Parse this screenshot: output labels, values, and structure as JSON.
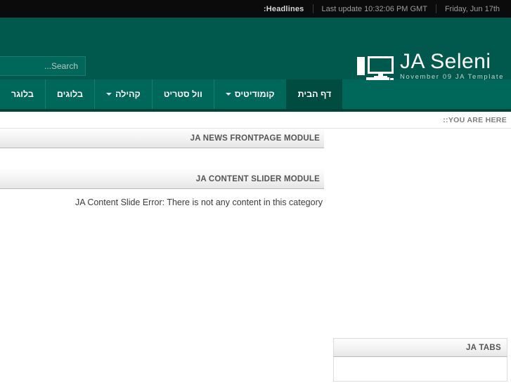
{
  "topbar": {
    "headlines_label": ":Headlines",
    "last_update_label": "Last update  10:32:06 PM GMT",
    "date_label": "Friday, Jun 17th"
  },
  "header": {
    "logo_title": "JA Seleni",
    "logo_tagline": "November 09 JA Template",
    "logo_icon": "desktop-computer-icon",
    "colors": {
      "header_bg": "#00594c",
      "nav_bg": "#00685a",
      "nav_active_bg": "#014c41",
      "topbar_bg": "#0b0b0b"
    }
  },
  "search": {
    "placeholder": "...Search",
    "value": "",
    "icon": "search-icon"
  },
  "nav": {
    "items": [
      {
        "label": "דף הבית",
        "active": true,
        "has_dropdown": false
      },
      {
        "label": "קומודיטיס",
        "active": false,
        "has_dropdown": true
      },
      {
        "label": "וול סטריט",
        "active": false,
        "has_dropdown": false
      },
      {
        "label": "קהילה",
        "active": false,
        "has_dropdown": true
      },
      {
        "label": "בלוגים",
        "active": false,
        "has_dropdown": false
      },
      {
        "label": "בלוגר",
        "active": false,
        "has_dropdown": false
      }
    ]
  },
  "breadcrumb": {
    "label": "::YOU ARE HERE"
  },
  "main": {
    "modules": [
      {
        "title": "JA NEWS FRONTPAGE MODULE",
        "body_text": ""
      },
      {
        "title": "JA CONTENT SLIDER MODULE",
        "body_text": "JA Content Slide Error: There is not any content in this category"
      }
    ]
  },
  "tabs_module": {
    "title": "JA TABS",
    "body_text": ""
  }
}
